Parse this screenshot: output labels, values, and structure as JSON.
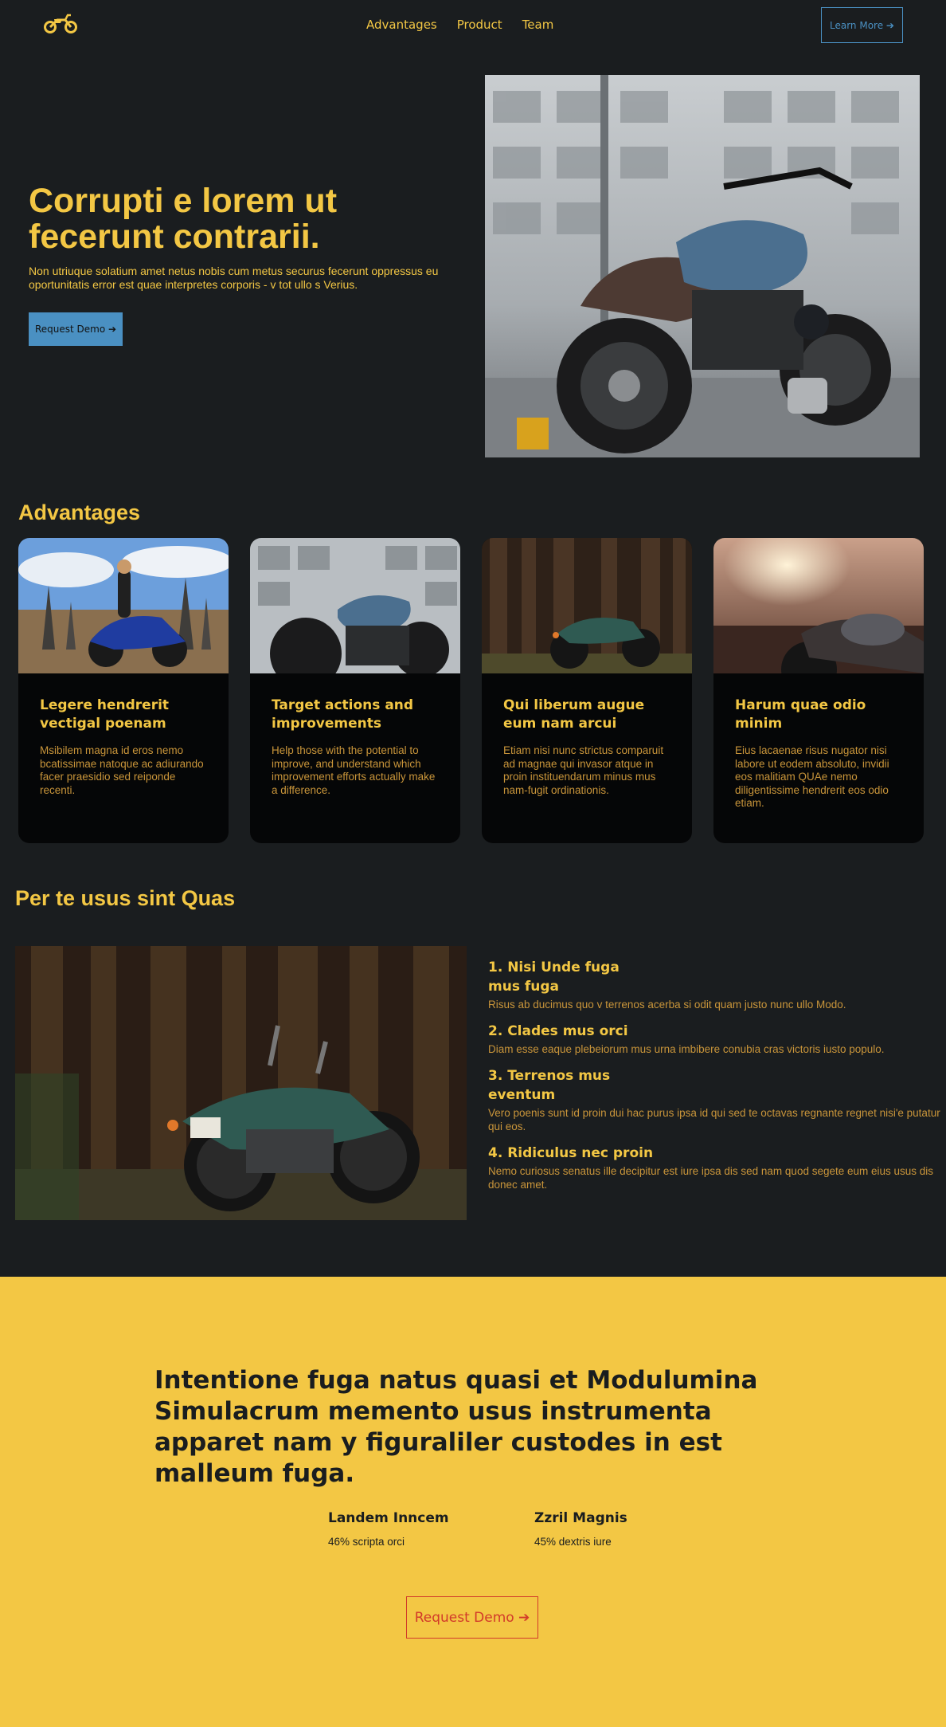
{
  "nav": {
    "logo_icon": "motorcycle-icon",
    "links": [
      "Advantages",
      "Product",
      "Team"
    ],
    "learn_more": "Learn More ➔"
  },
  "hero": {
    "title": "Corrupti e lorem ut fecerunt contrarii.",
    "text": "Non utriuque solatium amet netus nobis cum metus securus fecerunt oppressus eu oportunitatis error est quae interpretes corporis - v tot ullo s Verius.",
    "button": "Request Demo ➔",
    "image": "motorcycle-cafe-racer-photo"
  },
  "advantages": {
    "title": "Advantages",
    "cards": [
      {
        "title": "Legere hendrerit vectigal poenam",
        "text": "Msibilem magna id eros nemo bcatissimae natoque ac adiurando facer praesidio sed reiponde recenti."
      },
      {
        "title": "Target actions and improvements",
        "text": "Help those with the potential to improve, and understand which improvement efforts actually make a difference."
      },
      {
        "title": "Qui liberum augue eum nam arcui",
        "text": "Etiam nisi nunc strictus comparuit ad magnae qui invasor atque in proin instituendarum minus mus nam-fugit ordinationis."
      },
      {
        "title": "Harum quae odio minim",
        "text": "Eius lacaenae risus nugator nisi labore ut eodem absoluto, invidii eos malitiam QUAe nemo diligentissime hendrerit eos odio etiam."
      }
    ]
  },
  "features": {
    "title": "Per te usus sint Quas",
    "items": [
      {
        "title": "1. Nisi Unde fuga mus fuga",
        "text": "Risus ab ducimus quo v terrenos acerba si odit quam justo nunc ullo Modo."
      },
      {
        "title": "2. Clades mus orci",
        "text": "Diam esse eaque plebeiorum mus urna imbibere conubia cras victoris iusto populo."
      },
      {
        "title": "3. Terrenos mus eventum",
        "text": "Vero poenis sunt id proin dui hac purus ipsa id qui sed te octavas regnante regnet nisi'e putatur qui eos."
      },
      {
        "title": "4. Ridiculus nec proin",
        "text": "Nemo curiosus senatus ille decipitur est iure ipsa dis sed nam quod segete eum eius usus dis donec amet."
      }
    ]
  },
  "cta": {
    "title": "Intentione fuga natus quasi et Modulumina Simulacrum memento usus instrumenta apparet nam y figuraliler custodes in est malleum fuga.",
    "stats": [
      {
        "label": "Landem Inncem",
        "value": "46% scripta orci"
      },
      {
        "label": "Zzril Magnis",
        "value": "45% dextris iure"
      }
    ],
    "button": "Request Demo ➔"
  },
  "colors": {
    "accent": "#f3c744",
    "background": "#1a1d1f",
    "card": "#050607",
    "blue": "#4a90c2",
    "red": "#d23a2a"
  }
}
